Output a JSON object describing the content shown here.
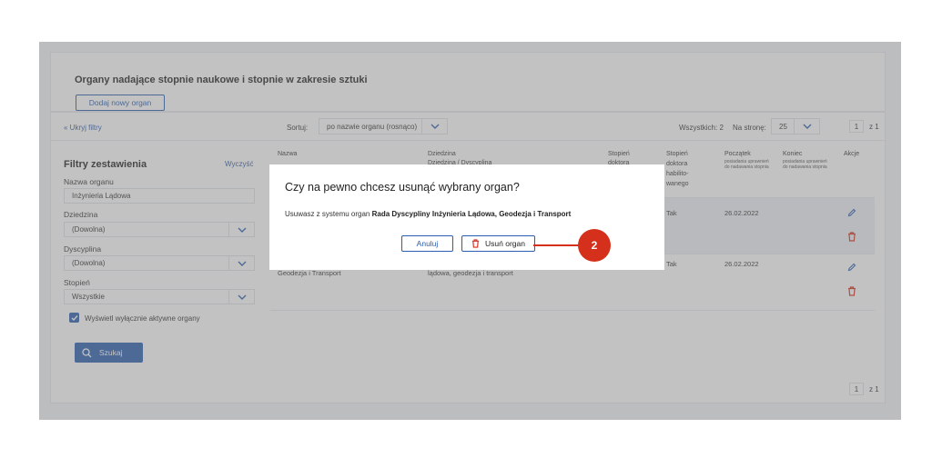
{
  "header": {
    "title": "Organy nadające stopnie naukowe i stopnie w zakresie sztuki",
    "add_button": "Dodaj nowy organ"
  },
  "filters": {
    "hide_link": "« Ukryj filtry",
    "title": "Filtry zestawienia",
    "clear": "Wyczyść",
    "organ_name_label": "Nazwa organu",
    "organ_name_value": "Inżynieria Lądowa",
    "field_label": "Dziedzina",
    "field_value": "(Dowolna)",
    "discipline_label": "Dyscyplina",
    "discipline_value": "(Dowolna)",
    "degree_label": "Stopień",
    "degree_value": "Wszystkie",
    "active_only": "Wyświetl wyłącznie aktywne organy",
    "search_button": "Szukaj"
  },
  "toolbar": {
    "sort_label": "Sortuj:",
    "sort_value": "po nazwie organu (rosnąco)",
    "total": "Wszystkich: 2",
    "per_page_label": "Na stronę:",
    "per_page_value": "25",
    "page": "1",
    "page_of": "z 1"
  },
  "table": {
    "headers": {
      "name": "Nazwa",
      "field": "Dziedzina",
      "field_sub": "Dziedzina / Dyscyplina",
      "deg_doctor": "Stopień",
      "deg_doctor_sub": "doktora",
      "deg_hab": "Stopień doktora habilito-wanego",
      "start": "Początek",
      "start_sub": "posiadania uprawnień do nadawania stopnia",
      "end": "Koniec",
      "end_sub": "posiadania uprawnień do nadawania stopnia",
      "actions": "Akcje"
    },
    "rows": [
      {
        "hab": "Tak",
        "start": "26.02.2022"
      },
      {
        "name": "Geodezja i Transport",
        "field": "lądowa, geodezja i transport",
        "hab": "Tak",
        "start": "26.02.2022"
      }
    ]
  },
  "modal": {
    "title": "Czy na pewno chcesz usunąć wybrany organ?",
    "text_prefix": "Usuwasz z systemu organ ",
    "text_bold": "Rada Dyscypliny Inżynieria Lądowa, Geodezja i Transport",
    "cancel": "Anuluj",
    "delete": "Usuń organ"
  },
  "callout": "2",
  "colors": {
    "accent": "#2a5db0",
    "danger": "#d5301c"
  }
}
